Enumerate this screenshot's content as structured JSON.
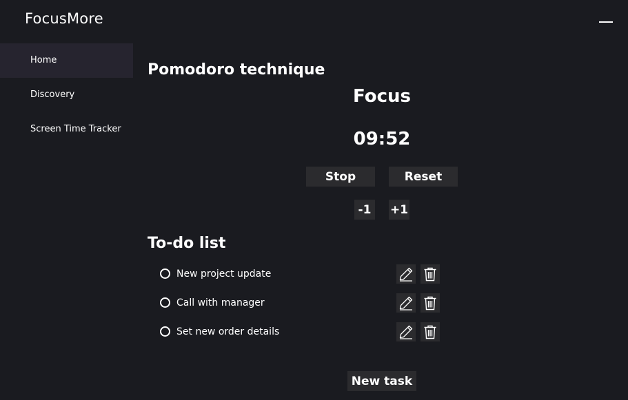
{
  "app": {
    "title": "FocusMore"
  },
  "sidebar": {
    "items": [
      {
        "label": "Home",
        "active": true
      },
      {
        "label": "Discovery",
        "active": false
      },
      {
        "label": "Screen Time Tracker",
        "active": false
      }
    ]
  },
  "pomodoro": {
    "title": "Pomodoro technique",
    "mode": "Focus",
    "time": "09:52",
    "stop_label": "Stop",
    "reset_label": "Reset",
    "minus_label": "-1",
    "plus_label": "+1"
  },
  "todo": {
    "title": "To-do list",
    "items": [
      {
        "label": "New project update",
        "done": false
      },
      {
        "label": "Call with manager",
        "done": false
      },
      {
        "label": "Set new order details",
        "done": false
      }
    ],
    "new_task_label": "New task"
  },
  "icons": {
    "edit": "pencil-icon",
    "delete": "trash-icon",
    "minimize": "minimize-icon",
    "checkbox": "circle-icon"
  },
  "colors": {
    "background": "#1a1b20",
    "sidebar_active": "#26242f",
    "button": "#2b2b2e",
    "text": "#ffffff"
  }
}
